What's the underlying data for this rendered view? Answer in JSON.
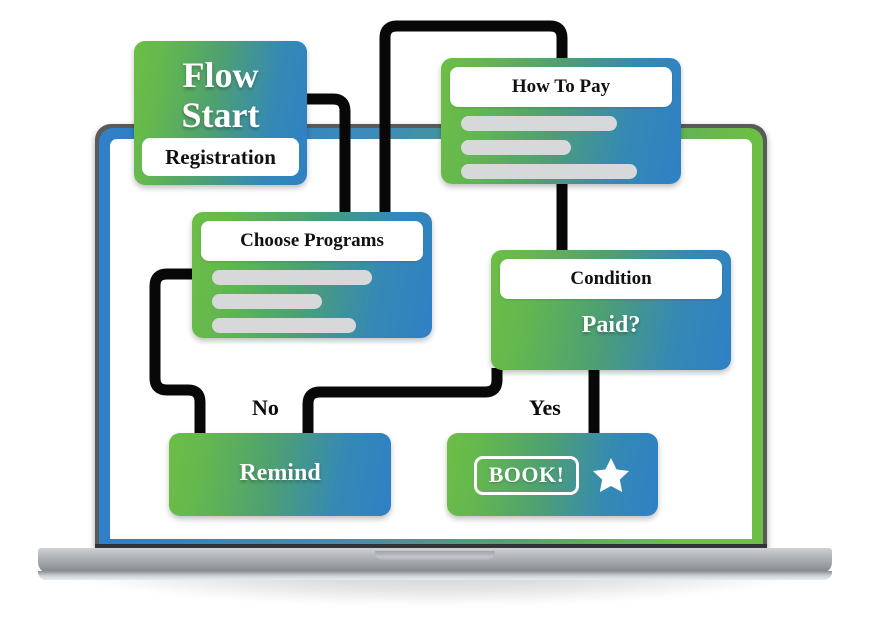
{
  "device": {
    "name": "laptop-mockup",
    "screen_label": "laptop-screen",
    "bezel_gradient_from": "#2f80c6",
    "bezel_gradient_to": "#6cbe45"
  },
  "theme": {
    "node_gradient_from": "#6cbe45",
    "node_gradient_to": "#2f80c6",
    "connector_color": "#080808",
    "title_bg": "#ffffff",
    "placeholder_bar": "#d6d8d9",
    "text_on_gradient": "#ffffff"
  },
  "chart_data": {
    "type": "diagram",
    "title": "Flow Start",
    "nodes": [
      {
        "id": "flow-start",
        "title": "Flow Start",
        "subtitle": "Registration",
        "kind": "start"
      },
      {
        "id": "choose-programs",
        "title": "Choose Programs",
        "kind": "form",
        "bars": 3
      },
      {
        "id": "how-to-pay",
        "title": "How To Pay",
        "kind": "form",
        "bars": 3
      },
      {
        "id": "condition",
        "title": "Condition",
        "value": "Paid?",
        "kind": "decision"
      },
      {
        "id": "remind",
        "title": "Remind",
        "kind": "action"
      },
      {
        "id": "book",
        "title": "BOOK!",
        "kind": "action",
        "icon": "star-icon"
      }
    ],
    "edges": [
      {
        "from": "flow-start",
        "to": "choose-programs",
        "label": ""
      },
      {
        "from": "choose-programs",
        "to": "how-to-pay",
        "label": ""
      },
      {
        "from": "how-to-pay",
        "to": "condition",
        "label": ""
      },
      {
        "from": "choose-programs",
        "to": "remind",
        "label": ""
      },
      {
        "from": "condition",
        "to": "remind",
        "label": "No"
      },
      {
        "from": "condition",
        "to": "book",
        "label": "Yes"
      }
    ]
  },
  "flow_start": {
    "line1": "Flow",
    "line2": "Start",
    "subtitle": "Registration"
  },
  "how_to_pay": {
    "title": "How To Pay"
  },
  "choose_programs": {
    "title": "Choose Programs"
  },
  "condition": {
    "title": "Condition",
    "value": "Paid?"
  },
  "remind": {
    "label": "Remind"
  },
  "book": {
    "label": "BOOK!",
    "icon": "star-icon"
  },
  "labels": {
    "no": "No",
    "yes": "Yes"
  }
}
